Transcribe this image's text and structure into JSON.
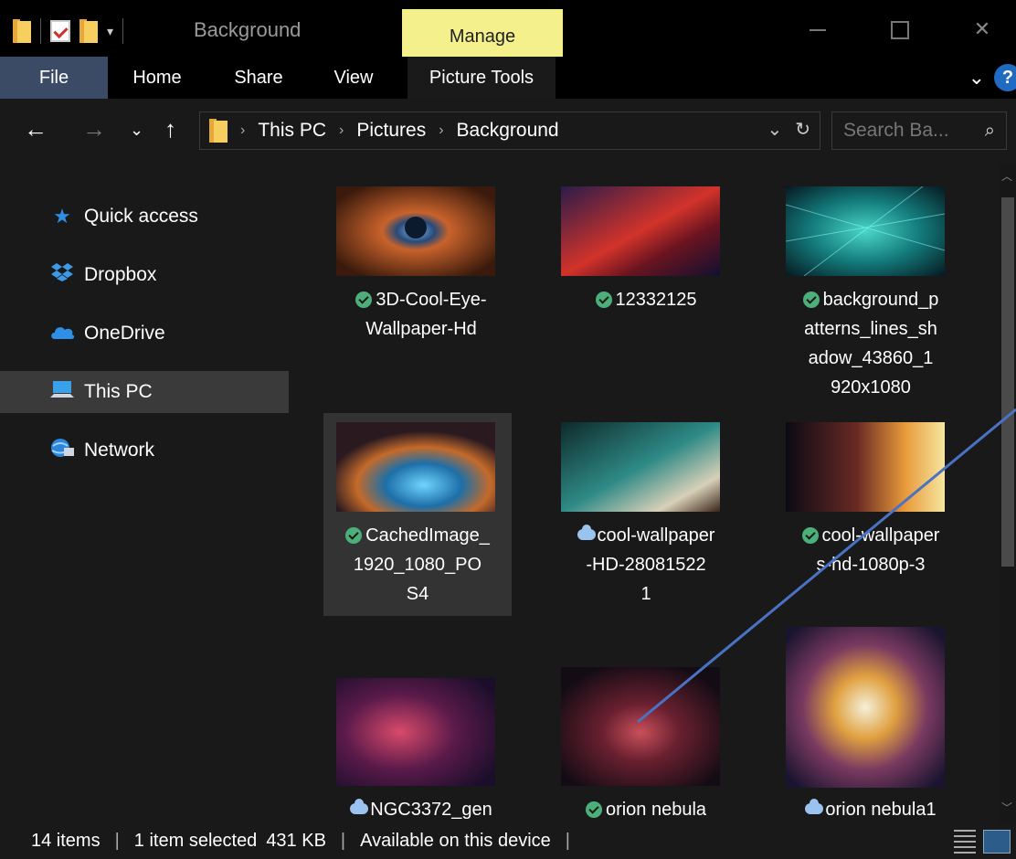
{
  "window": {
    "title": "Background",
    "manage_label": "Manage",
    "qat_dropdown": "▾"
  },
  "ribbon": {
    "tabs": [
      "File",
      "Home",
      "Share",
      "View",
      "Picture Tools"
    ],
    "help": "?"
  },
  "nav": {
    "breadcrumb": [
      "This PC",
      "Pictures",
      "Background"
    ],
    "search_placeholder": "Search Ba..."
  },
  "sidebar": {
    "items": [
      {
        "label": "Quick access",
        "icon": "star-icon"
      },
      {
        "label": "Dropbox",
        "icon": "dropbox-icon"
      },
      {
        "label": "OneDrive",
        "icon": "onedrive-icon"
      },
      {
        "label": "This PC",
        "icon": "computer-icon",
        "selected": true
      },
      {
        "label": "Network",
        "icon": "network-icon"
      }
    ]
  },
  "files": [
    {
      "name": "3D-Cool-Eye-Wallpaper-Hd",
      "lines": [
        "3D-Cool-Eye-",
        "Wallpaper-Hd"
      ],
      "status": "synced"
    },
    {
      "name": "12332125",
      "lines": [
        "12332125"
      ],
      "status": "synced"
    },
    {
      "name": "background_patterns_lines_shadow_43860_1920x1080",
      "lines": [
        "background_p",
        "atterns_lines_sh",
        "adow_43860_1",
        "920x1080"
      ],
      "status": "synced"
    },
    {
      "name": "CachedImage_1920_1080_POS4",
      "lines": [
        "CachedImage_",
        "1920_1080_PO",
        "S4"
      ],
      "status": "synced",
      "selected": true
    },
    {
      "name": "cool-wallpaper-HD-280815221",
      "lines": [
        "cool-wallpaper",
        "-HD-28081522",
        "1"
      ],
      "status": "cloud"
    },
    {
      "name": "cool-wallpapers-hd-1080p-3",
      "lines": [
        "cool-wallpaper",
        "s-hd-1080p-3"
      ],
      "status": "synced"
    },
    {
      "name": "NGC3372_gen",
      "lines": [
        "NGC3372_gen"
      ],
      "status": "cloud"
    },
    {
      "name": "orion nebula",
      "lines": [
        "orion nebula"
      ],
      "status": "synced"
    },
    {
      "name": "orion nebula1",
      "lines": [
        "orion nebula1"
      ],
      "status": "cloud"
    }
  ],
  "status": {
    "count": "14 items",
    "selection": "1 item selected",
    "size": "431 KB",
    "availability": "Available on this device"
  },
  "colors": {
    "manage_tab": "#f4f08b",
    "file_tab": "#3b4b66",
    "synced": "#4caf7a",
    "cloud": "#9bc3f0",
    "annotation_line": "#4a72c4"
  }
}
